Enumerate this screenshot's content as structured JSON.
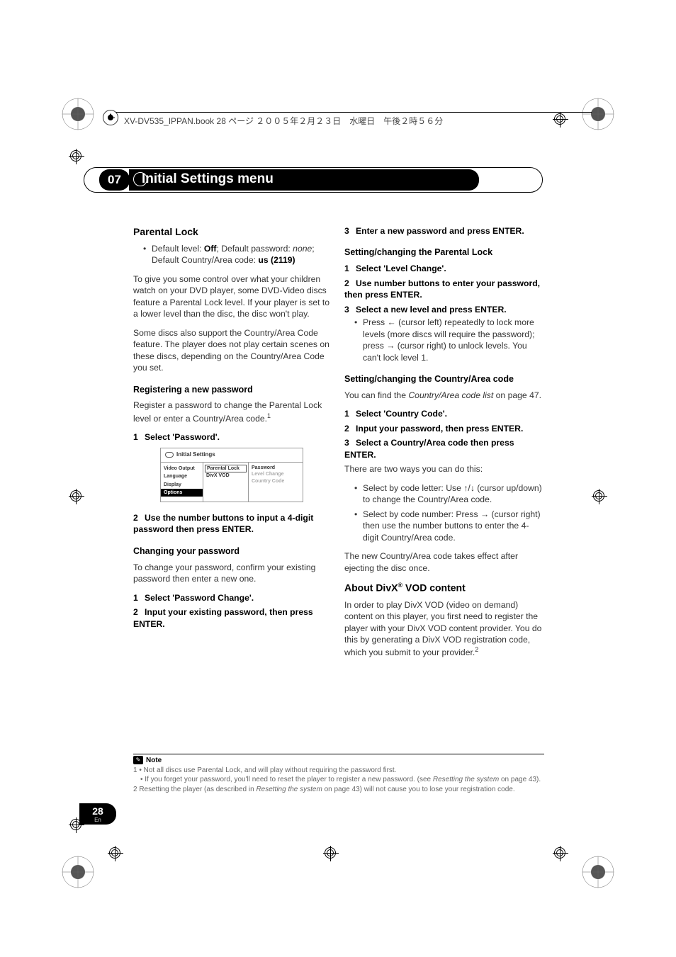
{
  "header_file": "XV-DV535_IPPAN.book 28 ページ ２００５年２月２３日　水曜日　午後２時５６分",
  "section_number": "07",
  "section_title": "Initial Settings menu",
  "page_number": "28",
  "page_lang": "En",
  "left": {
    "h_parental": "Parental Lock",
    "bullet_default_a": "Default level: ",
    "bullet_default_off": "Off",
    "bullet_default_b": "; Default password: ",
    "bullet_default_none": "none",
    "bullet_default_c": "; Default Country/Area code: ",
    "bullet_default_us": "us (2119)",
    "para1": "To give you some control over what your children watch on your DVD player, some DVD-Video discs feature a Parental Lock level. If your player is set to a lower level than the disc, the disc won't play.",
    "para2": "Some discs also support the Country/Area Code feature. The player does not play certain scenes on these discs, depending on the Country/Area Code you set.",
    "h_register": "Registering a new password",
    "para_register": "Register a password to change the Parental Lock level or enter a Country/Area code.",
    "step1": "Select 'Password'.",
    "ui": {
      "title": "Initial Settings",
      "c1": [
        "Video Output",
        "Language",
        "Display",
        "Options"
      ],
      "c2": [
        "Parental Lock",
        "DivX VOD"
      ],
      "c3": [
        "Password",
        "Level Change",
        "Country Code"
      ]
    },
    "step2": "Use the number buttons to input a 4-digit password then press ENTER.",
    "h_changing": "Changing your password",
    "para_changing": "To change your password, confirm your existing password then enter a new one.",
    "step_c1": "Select 'Password Change'.",
    "step_c2": "Input your existing password, then press ENTER."
  },
  "right": {
    "step3": "Enter a new password and press ENTER.",
    "h_setlock": "Setting/changing the Parental Lock",
    "sl_step1": "Select 'Level Change'.",
    "sl_step2": "Use number buttons to enter your password, then press ENTER.",
    "sl_step3": "Select a new level and press ENTER.",
    "sl_bullet_a": "Press ",
    "sl_bullet_b": " (cursor left) repeatedly to lock more levels (more discs will require the password); press ",
    "sl_bullet_c": " (cursor right) to unlock levels. You can't lock level 1.",
    "h_setcountry": "Setting/changing the Country/Area code",
    "sc_intro_a": "You can find the ",
    "sc_intro_i": "Country/Area code list",
    "sc_intro_b": " on page 47.",
    "sc_step1": "Select 'Country Code'.",
    "sc_step2": "Input your password, then press ENTER.",
    "sc_step3": "Select a Country/Area code then press ENTER.",
    "sc_ways": "There are two ways you can do this:",
    "sc_b1a": "Select by code letter: Use ",
    "sc_b1b": " (cursor up/down) to change the Country/Area code.",
    "sc_b2a": "Select by code number: Press ",
    "sc_b2b": " (cursor right) then use the number buttons to enter the 4-digit Country/Area code.",
    "sc_after": "The new Country/Area code takes effect after ejecting the disc once.",
    "h_divx_a": "About DivX",
    "h_divx_b": " VOD content",
    "divx_para": "In order to play DivX VOD (video on demand) content on this player, you first need to register the player with your DivX VOD content provider. You do this by generating a DivX VOD registration code, which you submit to your provider."
  },
  "notes": {
    "title": "Note",
    "n1a": "1 • Not all discs use Parental Lock, and will play without requiring the password first.",
    "n1b_a": "• If you forget your password, you'll need to reset the player to register a new password. (see ",
    "n1b_i": "Resetting the system",
    "n1b_b": " on page 43).",
    "n2_a": "2 Resetting the player (as described in ",
    "n2_i": "Resetting the system",
    "n2_b": " on page 43) will not cause you to lose your registration code."
  }
}
